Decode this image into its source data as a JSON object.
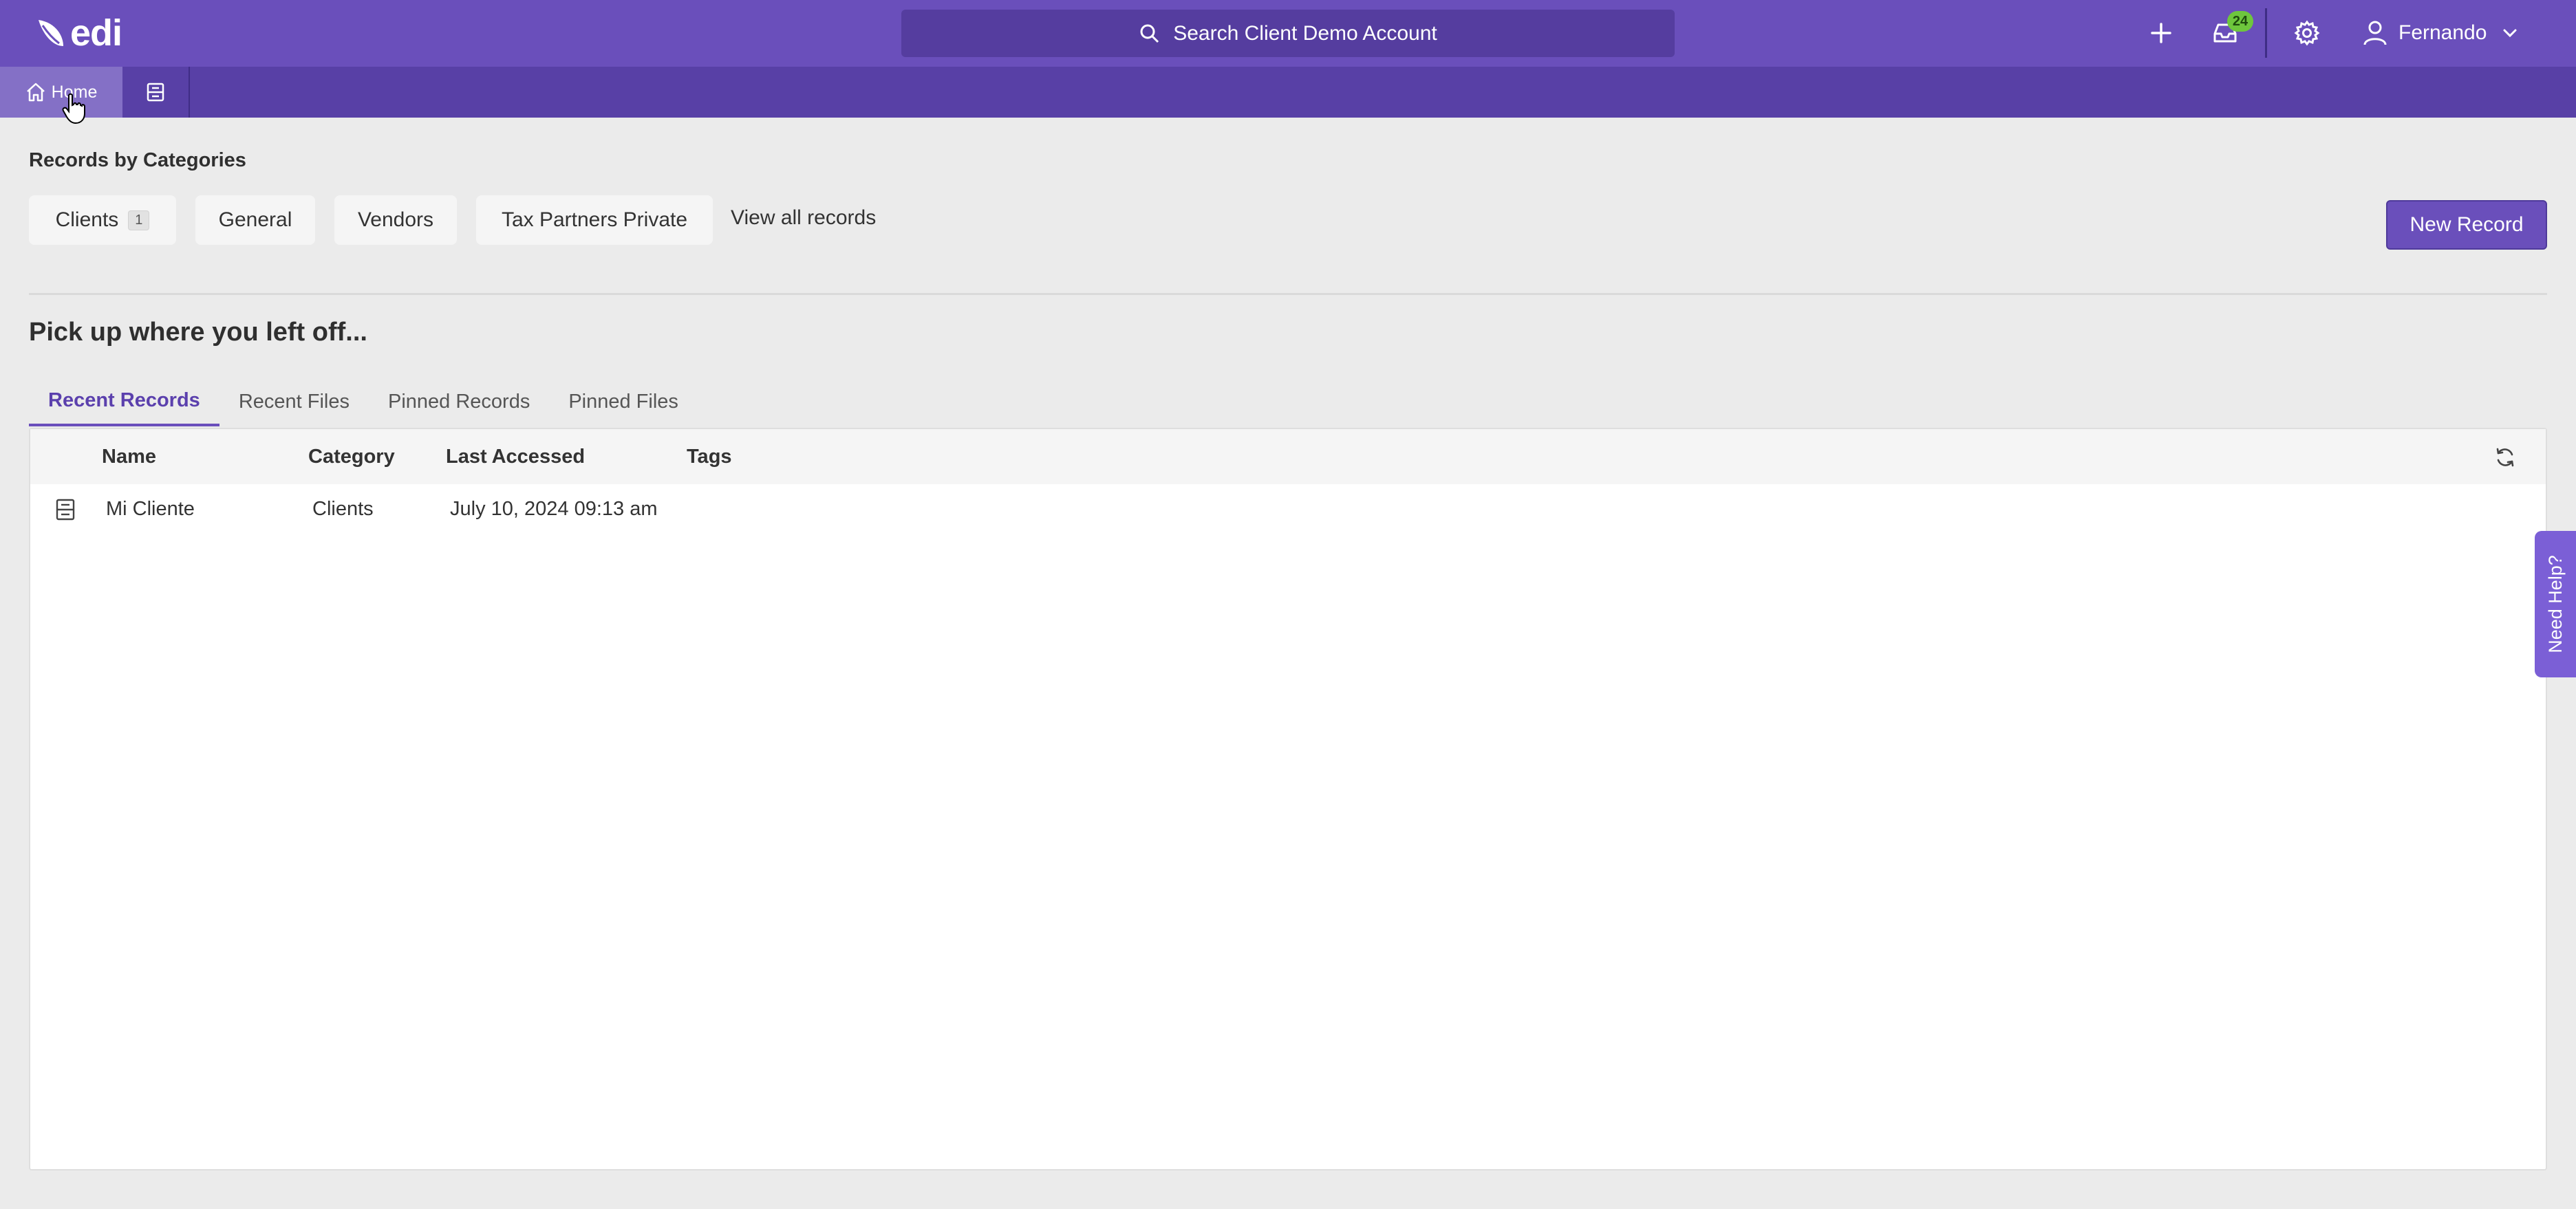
{
  "app": {
    "logo_text": "edi"
  },
  "header": {
    "search_placeholder": "Search Client Demo Account",
    "inbox_count": "24",
    "user_name": "Fernando"
  },
  "nav_tabs": {
    "home_label": "Home"
  },
  "categories": {
    "title": "Records by Categories",
    "items": [
      {
        "label": "Clients",
        "count": "1"
      },
      {
        "label": "General"
      },
      {
        "label": "Vendors"
      },
      {
        "label": "Tax Partners Private"
      }
    ],
    "view_all_label": "View all records",
    "new_record_label": "New Record"
  },
  "pickup": {
    "title": "Pick up where you left off...",
    "tabs": [
      "Recent Records",
      "Recent Files",
      "Pinned Records",
      "Pinned Files"
    ],
    "active_tab": "Recent Records",
    "columns": [
      "Name",
      "Category",
      "Last Accessed",
      "Tags"
    ],
    "rows": [
      {
        "name": "Mi Cliente",
        "category": "Clients",
        "last_accessed": "July 10, 2024 09:13 am",
        "tags": ""
      }
    ]
  },
  "help": {
    "label": "Need Help?"
  },
  "colors": {
    "brand": "#6a4fbb",
    "brand_dark": "#5840a6",
    "badge": "#6ec63d"
  }
}
